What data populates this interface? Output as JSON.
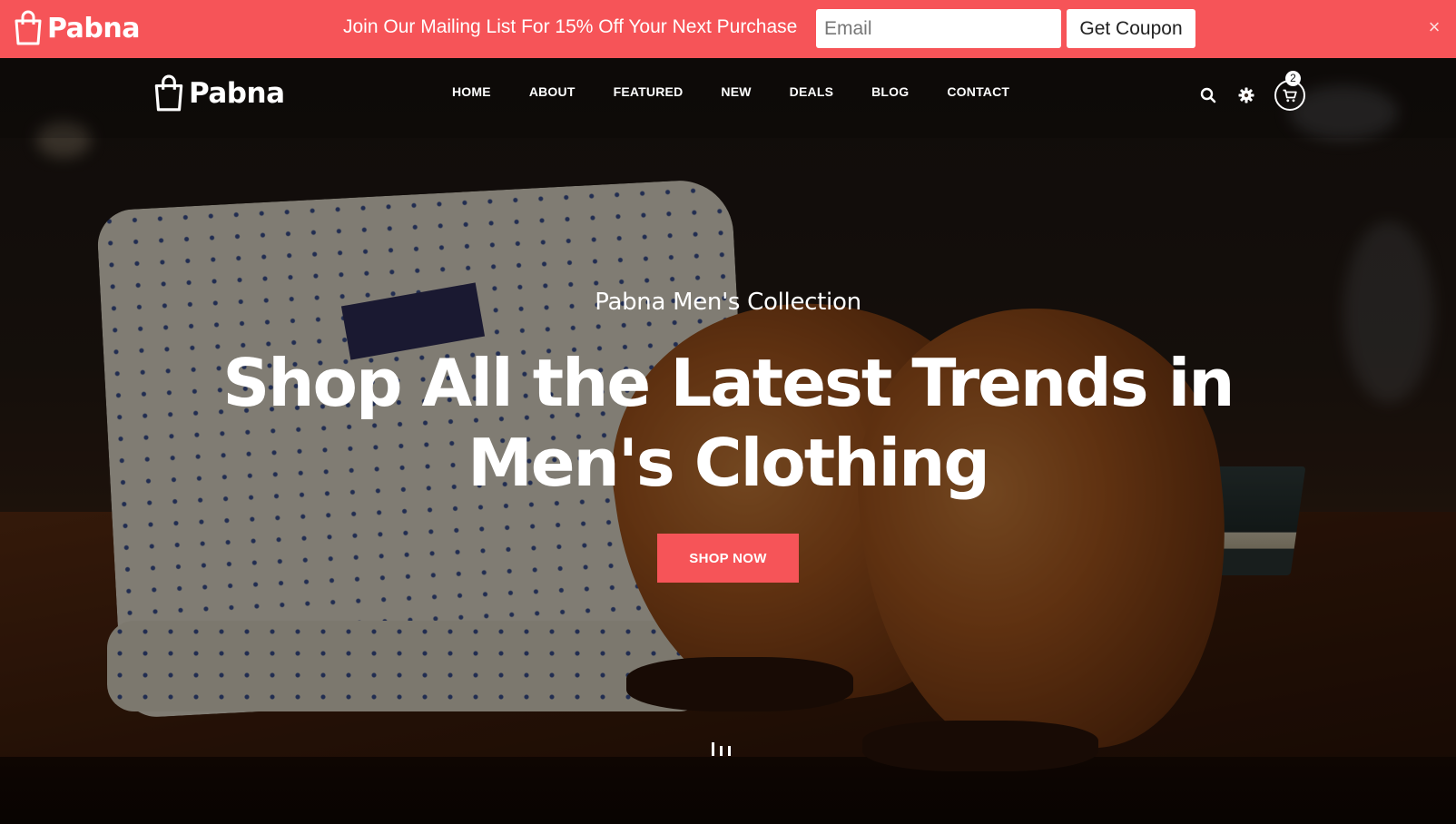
{
  "promo": {
    "brand": "Pabna",
    "message": "Join Our Mailing List For 15% Off Your Next Purchase",
    "email_placeholder": "Email",
    "button_label": "Get Coupon",
    "close_symbol": "×",
    "background_color": "#f65458"
  },
  "nav": {
    "brand": "Pabna",
    "items": [
      {
        "label": "HOME"
      },
      {
        "label": "ABOUT"
      },
      {
        "label": "FEATURED"
      },
      {
        "label": "NEW"
      },
      {
        "label": "DEALS"
      },
      {
        "label": "BLOG"
      },
      {
        "label": "CONTACT"
      }
    ],
    "icons": [
      "search-icon",
      "gear-icon",
      "cart-icon"
    ],
    "cart_count": "2"
  },
  "hero": {
    "subtitle": "Pabna Men's Collection",
    "title": "Shop All the Latest Trends in Men's Clothing",
    "cta_label": "SHOP NOW",
    "slides": 3,
    "active_slide": 1
  }
}
